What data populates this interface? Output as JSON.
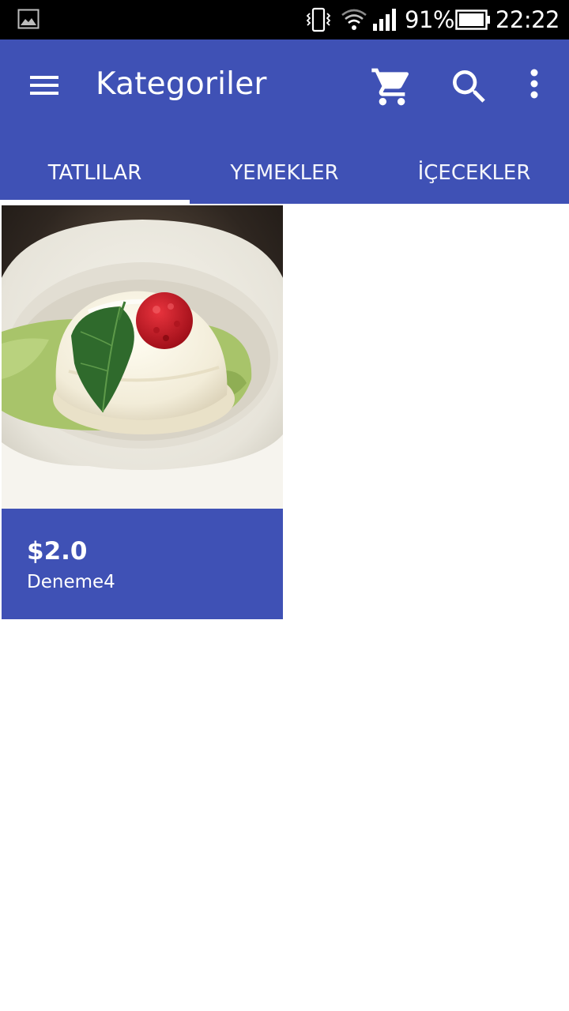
{
  "status_bar": {
    "battery_percent": "91%",
    "time": "22:22",
    "icons": [
      "gallery-icon",
      "vibrate-icon",
      "wifi-icon",
      "signal-icon",
      "battery-icon"
    ]
  },
  "app_bar": {
    "title": "Kategoriler",
    "actions": [
      "menu-icon",
      "cart-icon",
      "search-icon",
      "more-vert-icon"
    ],
    "color": "#3f51b5"
  },
  "tabs": [
    {
      "label": "TATLILAR",
      "selected": true
    },
    {
      "label": "YEMEKLER",
      "selected": false
    },
    {
      "label": "İÇECEKLER",
      "selected": false
    }
  ],
  "products": [
    {
      "price": "$2.0",
      "name": "Deneme4",
      "image": "dessert-photo"
    }
  ]
}
